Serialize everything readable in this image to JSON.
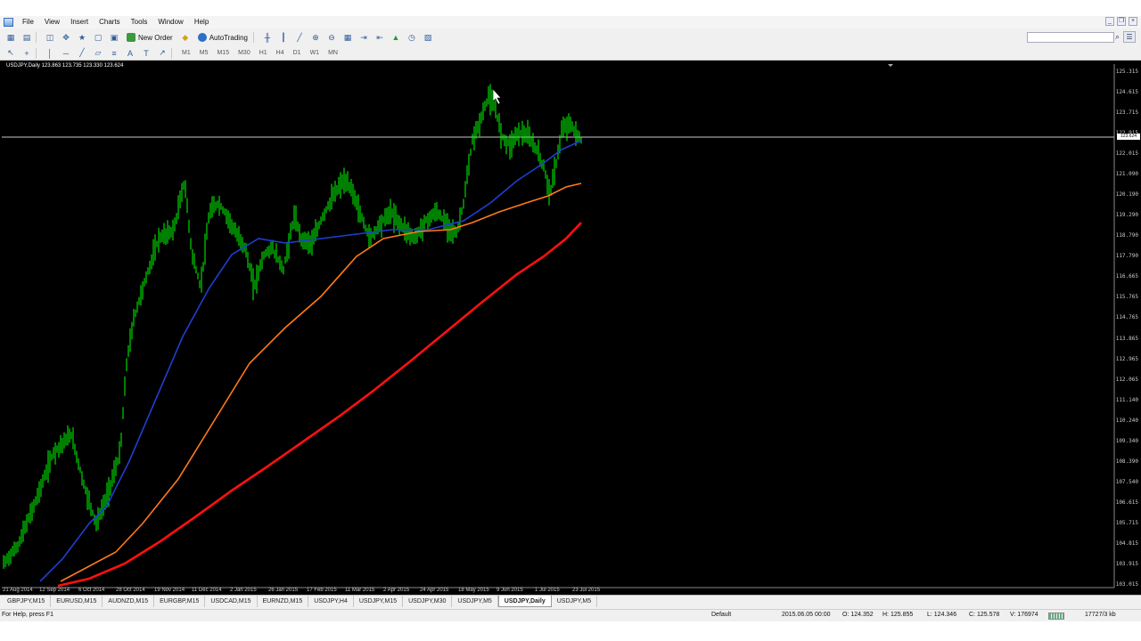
{
  "menu": [
    "File",
    "View",
    "Insert",
    "Charts",
    "Tools",
    "Window",
    "Help"
  ],
  "toolbar": {
    "new_order": "New Order",
    "autotrading": "AutoTrading"
  },
  "timeframes": [
    "M1",
    "M5",
    "M15",
    "M30",
    "H1",
    "H4",
    "D1",
    "W1",
    "MN"
  ],
  "chart": {
    "label": "USDJPY,Daily  123.863 123.735 123.330 123.624",
    "current_price": "123.624",
    "y_labels": [
      "125.315",
      "124.615",
      "123.715",
      "122.915",
      "122.015",
      "121.090",
      "120.190",
      "119.290",
      "118.790",
      "117.790",
      "116.665",
      "115.765",
      "114.765",
      "113.865",
      "112.965",
      "112.065",
      "111.140",
      "110.240",
      "109.340",
      "108.390",
      "107.540",
      "106.615",
      "105.715",
      "104.815",
      "103.915",
      "103.015"
    ],
    "x_labels": [
      "21 Aug 2014",
      "12 Sep 2014",
      "6 Oct 2014",
      "28 Oct 2014",
      "19 Nov 2014",
      "11 Dec 2014",
      "2 Jan 2015",
      "26 Jan 2015",
      "17 Feb 2015",
      "11 Mar 2015",
      "2 Apr 2015",
      "24 Apr 2015",
      "18 May 2015",
      "9 Jun 2015",
      "1 Jul 2015",
      "23 Jul 2015"
    ],
    "colors": {
      "background": "#000000",
      "bars": "#00ff00",
      "ma_fast": "#1f3fd0",
      "ma_mid": "#ff7a1a",
      "ma_slow": "#ff1010",
      "grid_line": "#c8c8c8"
    }
  },
  "tabs": [
    {
      "label": "GBPJPY,M15",
      "active": false
    },
    {
      "label": "EURUSD,M15",
      "active": false
    },
    {
      "label": "AUDNZD,M15",
      "active": false
    },
    {
      "label": "EURGBP,M15",
      "active": false
    },
    {
      "label": "USDCAD,M15",
      "active": false
    },
    {
      "label": "EURNZD,M15",
      "active": false
    },
    {
      "label": "USDJPY,H4",
      "active": false
    },
    {
      "label": "USDJPY,M15",
      "active": false
    },
    {
      "label": "USDJPY,M30",
      "active": false
    },
    {
      "label": "USDJPY,M5",
      "active": false
    },
    {
      "label": "USDJPY,Daily",
      "active": true
    },
    {
      "label": "USDJPY,M5",
      "active": false
    }
  ],
  "status": {
    "help": "For Help, press F1",
    "profile": "Default",
    "datetime": "2015.06.05 00:00",
    "open": "O: 124.352",
    "high": "H: 125.855",
    "low": "L: 124.346",
    "close": "C: 125.578",
    "volume": "V: 176974",
    "traffic": "17727/3 kb"
  }
}
